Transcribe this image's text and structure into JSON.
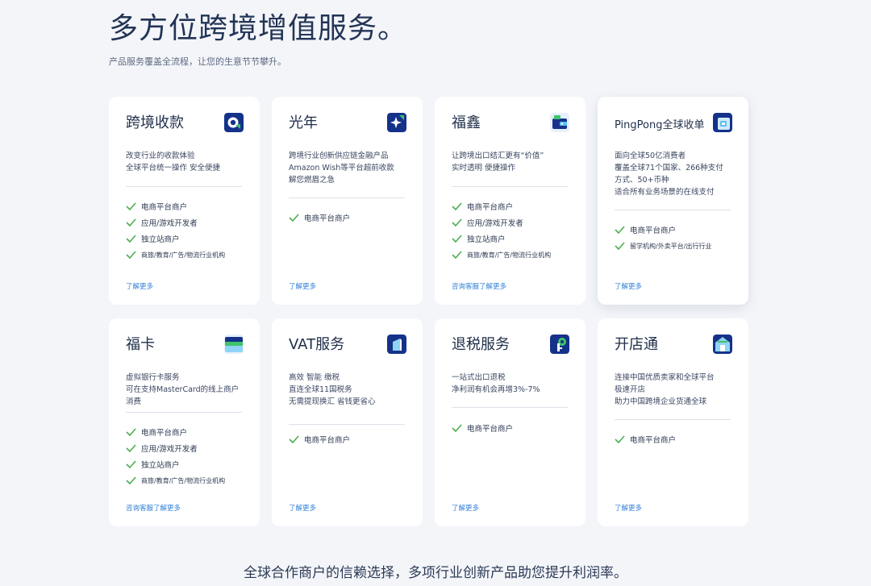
{
  "hero": {
    "title": "多方位跨境增值服务。",
    "subtitle": "产品服务覆盖全流程，让您的生意节节攀升。"
  },
  "colors": {
    "accent": "#2f7fd6",
    "check": "#4caf50",
    "brand_dark": "#15328a"
  },
  "cards": [
    {
      "title": "跨境收款",
      "icon": "payment-q-icon",
      "desc": [
        "改变行业的收款体验",
        "全球平台统一操作 安全便捷"
      ],
      "features": [
        "电商平台商户",
        "应用/游戏开发者",
        "独立站商户",
        "商旅/教育/广告/物流行业机构"
      ],
      "link": "了解更多"
    },
    {
      "title": "光年",
      "icon": "lightyear-star-icon",
      "desc": [
        "跨境行业创新供应链金融产品",
        "Amazon Wish等平台超前收款",
        "解您燃眉之急"
      ],
      "features": [
        "电商平台商户"
      ],
      "link": "了解更多"
    },
    {
      "title": "福鑫",
      "icon": "wallet-icon",
      "desc": [
        "让跨境出口结汇更有“价值”",
        "实时透明 便捷操作"
      ],
      "features": [
        "电商平台商户",
        "应用/游戏开发者",
        "独立站商户",
        "商旅/教育/广告/物流行业机构"
      ],
      "link": "咨询客服了解更多"
    },
    {
      "title": "PingPong全球收单",
      "icon": "card-terminal-icon",
      "desc": [
        "面向全球50亿消费者",
        "覆盖全球71个国家、266种支付",
        "方式、50+币种",
        "适合所有业务场景的在线支付"
      ],
      "features": [
        "电商平台商户",
        "留学机构/外卖平台/出行行业"
      ],
      "link": "了解更多"
    },
    {
      "title": "福卡",
      "icon": "virtual-card-icon",
      "desc": [
        "虚拟银行卡服务",
        "可在支持MasterCard的线上商户",
        "消费"
      ],
      "features": [
        "电商平台商户",
        "应用/游戏开发者",
        "独立站商户",
        "商旅/教育/广告/物流行业机构"
      ],
      "link": "咨询客服了解更多"
    },
    {
      "title": "VAT服务",
      "icon": "vat-document-icon",
      "desc": [
        "高效 智能 缴税",
        "直连全球11国税务",
        "无需提现换汇 省钱更省心"
      ],
      "features": [
        "电商平台商户"
      ],
      "link": "了解更多"
    },
    {
      "title": "退税服务",
      "icon": "tax-refund-icon",
      "desc": [
        "一站式出口退税",
        "净利润有机会再增3%-7%"
      ],
      "features": [
        "电商平台商户"
      ],
      "link": "了解更多"
    },
    {
      "title": "开店通",
      "icon": "storefront-icon",
      "desc": [
        "连接中国优质卖家和全球平台",
        "极速开店",
        "助力中国跨境企业货通全球"
      ],
      "features": [
        "电商平台商户"
      ],
      "link": "了解更多"
    }
  ],
  "footer": {
    "text": "全球合作商户的信赖选择，多项行业创新产品助您提升利润率。"
  }
}
